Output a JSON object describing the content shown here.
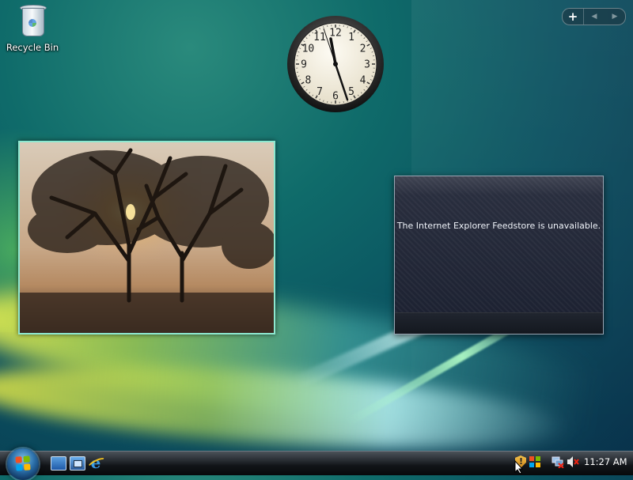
{
  "desktop": {
    "icons": [
      {
        "label": "Recycle Bin",
        "icon": "recycle-bin-icon"
      }
    ]
  },
  "sidebar": {
    "add_gadget_label": "+",
    "prev_label": "◀",
    "next_label": "▶"
  },
  "clock_gadget": {
    "numerals": [
      "12",
      "1",
      "2",
      "3",
      "4",
      "5",
      "6",
      "7",
      "8",
      "9",
      "10",
      "11"
    ],
    "time": "11:27"
  },
  "slideshow_gadget": {
    "image": "misty-trees-sunrise"
  },
  "feed_gadget": {
    "message": "The Internet Explorer Feedstore is unavailable."
  },
  "taskbar": {
    "start_icon": "windows-start-orb",
    "quick_launch": [
      "show-desktop-icon",
      "switch-windows-icon",
      "internet-explorer-icon"
    ],
    "tray_icons": [
      "security-shield-icon",
      "windows-update-icon",
      "network-disconnected-icon",
      "volume-muted-icon"
    ],
    "clock": "11:27 AM"
  },
  "colors": {
    "desktop_teal": "#0f6b6a",
    "slideshow_border": "#8de8d0",
    "taskbar_black": "#111418"
  }
}
